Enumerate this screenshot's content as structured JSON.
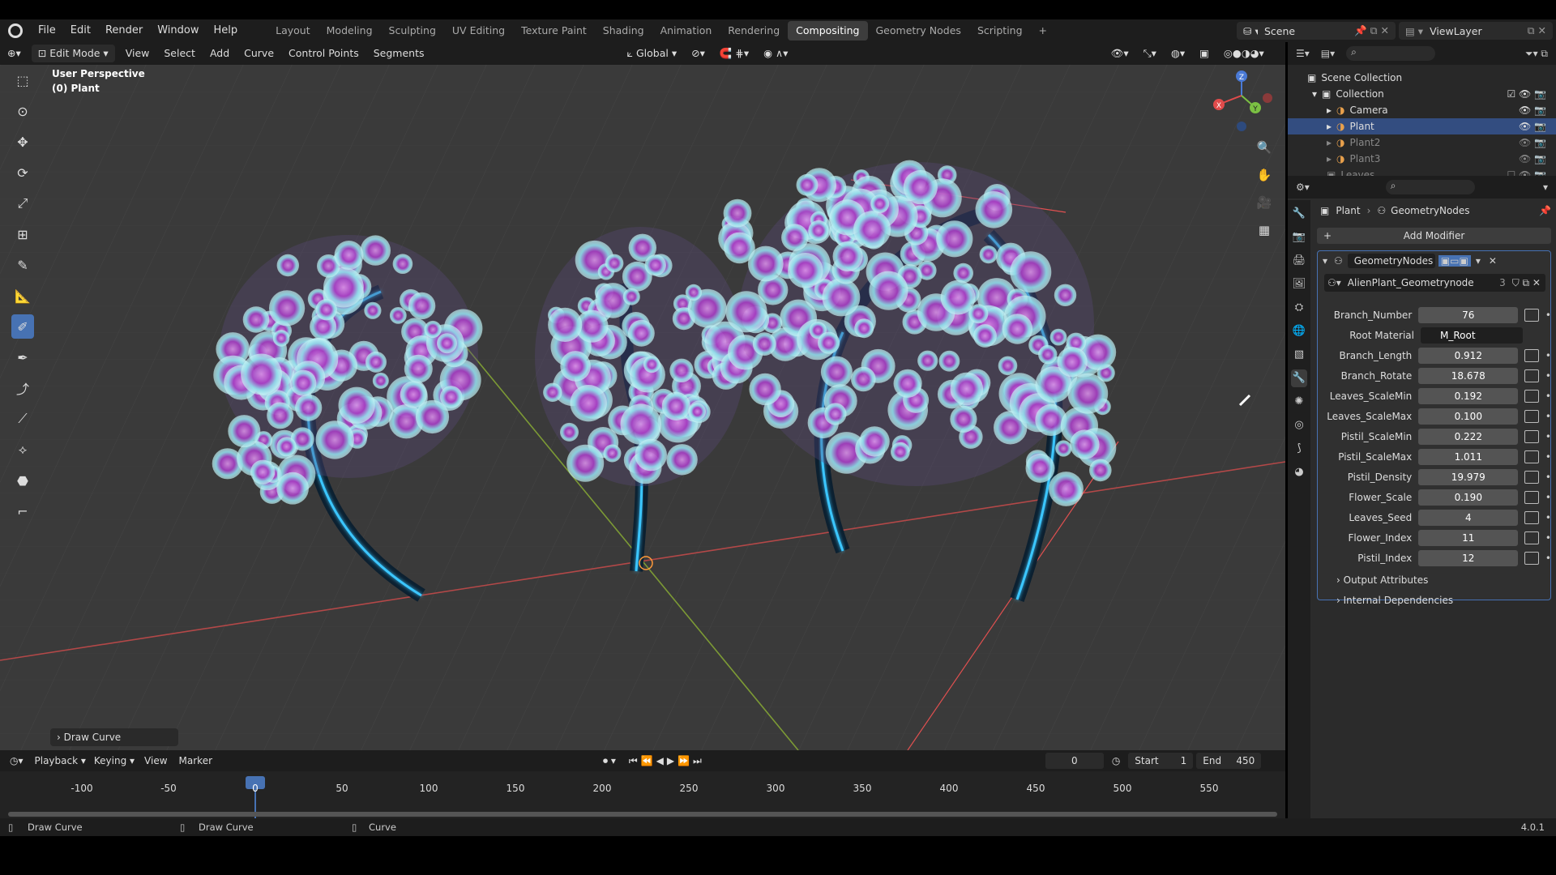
{
  "app": {
    "version": "4.0.1"
  },
  "menu": [
    "File",
    "Edit",
    "Render",
    "Window",
    "Help"
  ],
  "workspaces": [
    "Layout",
    "Modeling",
    "Sculpting",
    "UV Editing",
    "Texture Paint",
    "Shading",
    "Animation",
    "Rendering",
    "Compositing",
    "Geometry Nodes",
    "Scripting"
  ],
  "active_workspace": "Compositing",
  "scene": {
    "scene_name": "Scene",
    "view_layer": "ViewLayer"
  },
  "header": {
    "mode": "Edit Mode",
    "menus": [
      "View",
      "Select",
      "Add",
      "Curve",
      "Control Points",
      "Segments"
    ],
    "transform_orientation": "Global"
  },
  "viewport": {
    "perspective_label": "User Perspective",
    "object_label": "(0) Plant",
    "redo_panel": "Draw Curve"
  },
  "outliner": {
    "root": "Scene Collection",
    "collection": "Collection",
    "items": [
      {
        "name": "Camera",
        "selected": false,
        "dim": false
      },
      {
        "name": "Plant",
        "selected": true,
        "dim": false
      },
      {
        "name": "Plant2",
        "selected": false,
        "dim": true
      },
      {
        "name": "Plant3",
        "selected": false,
        "dim": true
      }
    ],
    "leaves": "Leaves"
  },
  "properties": {
    "breadcrumb_object": "Plant",
    "breadcrumb_modifier": "GeometryNodes",
    "add_modifier": "Add Modifier",
    "modifier_name": "GeometryNodes",
    "node_group": "AlienPlant_Geometrynode",
    "node_group_users": "3",
    "fields": [
      {
        "label": "Branch_Number",
        "value": "76"
      },
      {
        "label": "Root Material",
        "value": "M_Root"
      },
      {
        "label": "Branch_Length",
        "value": "0.912"
      },
      {
        "label": "Branch_Rotate",
        "value": "18.678"
      },
      {
        "label": "Leaves_ScaleMin",
        "value": "0.192"
      },
      {
        "label": "Leaves_ScaleMax",
        "value": "0.100"
      },
      {
        "label": "Pistil_ScaleMin",
        "value": "0.222"
      },
      {
        "label": "Pistil_ScaleMax",
        "value": "1.011"
      },
      {
        "label": "Pistil_Density",
        "value": "19.979"
      },
      {
        "label": "Flower_Scale",
        "value": "0.190"
      },
      {
        "label": "Leaves_Seed",
        "value": "4"
      },
      {
        "label": "Flower_Index",
        "value": "11"
      },
      {
        "label": "Pistil_Index",
        "value": "12"
      }
    ],
    "output_attributes": "Output Attributes",
    "internal_dependencies": "Internal Dependencies"
  },
  "timeline": {
    "menus": [
      "Playback",
      "Keying",
      "View",
      "Marker"
    ],
    "current_frame": "0",
    "start_label": "Start",
    "start": "1",
    "end_label": "End",
    "end": "450",
    "ticks": [
      "-100",
      "-50",
      "0",
      "50",
      "100",
      "150",
      "200",
      "250",
      "300",
      "350",
      "400",
      "450",
      "500",
      "550"
    ]
  },
  "statusbar": {
    "left": "Draw Curve",
    "middle": "Draw Curve",
    "right": "Curve"
  },
  "colors": {
    "accent": "#4772b3",
    "x_axis": "#c44a4a",
    "y_axis": "#7ea03a",
    "curve_glow": "#38c8ff",
    "flower_purple": "#b23cc4",
    "flower_cyan": "#9fe7ea"
  }
}
